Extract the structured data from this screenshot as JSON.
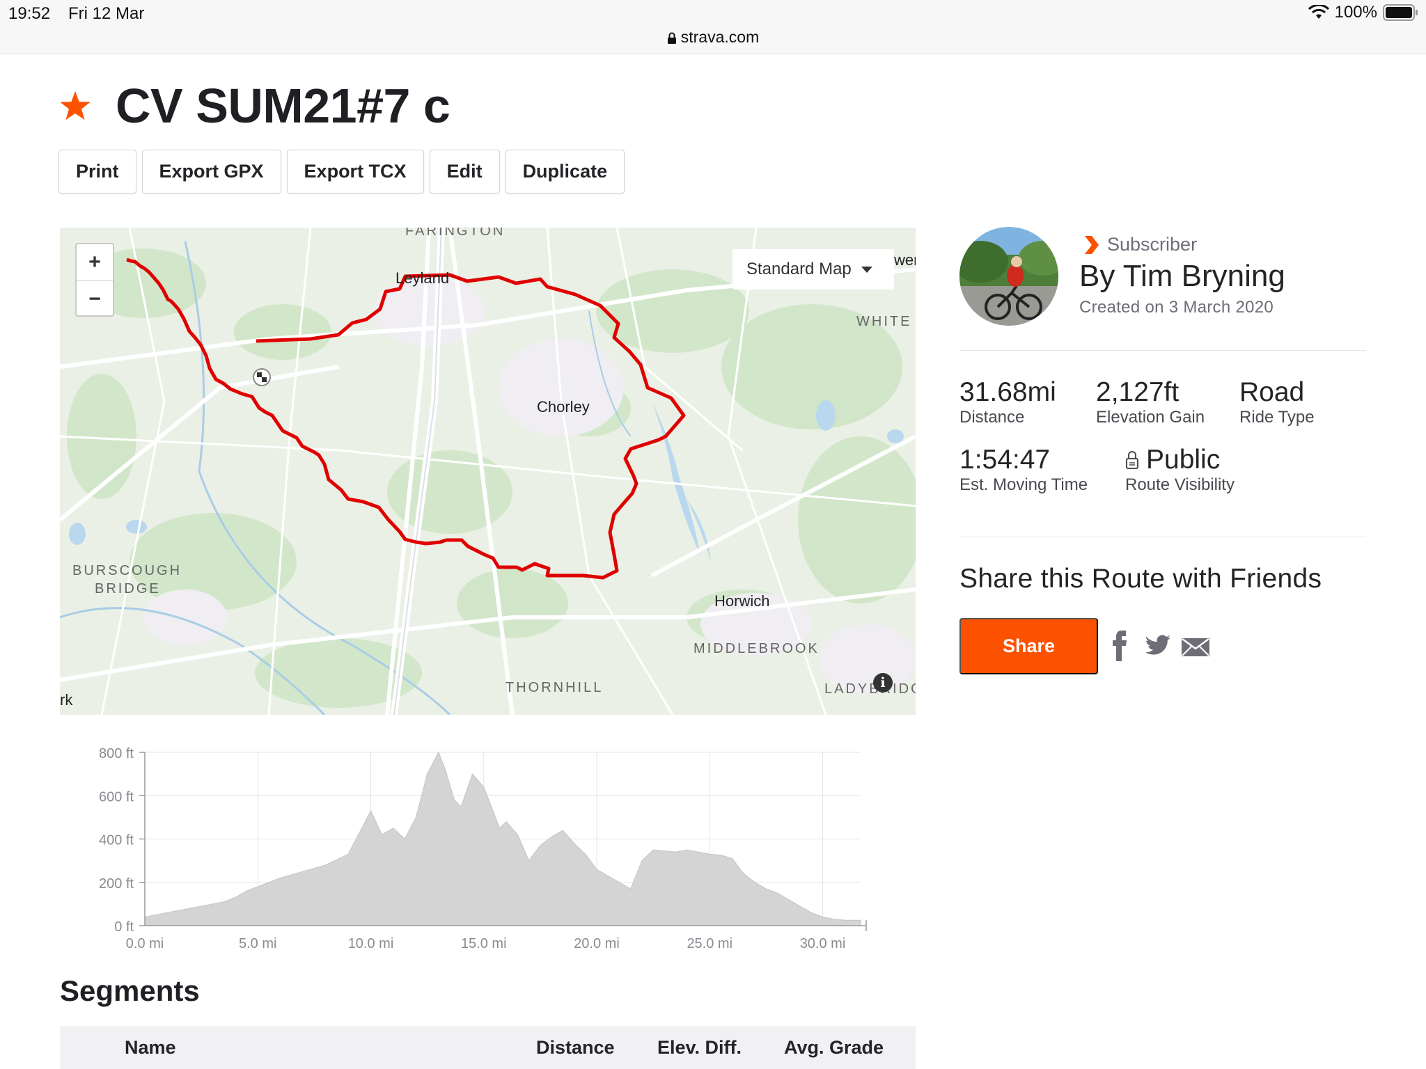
{
  "status_bar": {
    "time": "19:52",
    "date": "Fri 12 Mar",
    "battery": "100%",
    "url": "strava.com"
  },
  "route": {
    "title": "CV SUM21#7 c"
  },
  "toolbar": {
    "buttons": [
      "Print",
      "Export GPX",
      "Export TCX",
      "Edit",
      "Duplicate"
    ]
  },
  "map": {
    "map_type": "Standard Map",
    "places": {
      "faringtn": "FARINGTON",
      "leyland": "Leyland",
      "wer": "wer",
      "whitet": "WHITE",
      "chorley": "Chorley",
      "burscough1": "BURSCOUGH",
      "burscough2": "BRIDGE",
      "horwich": "Horwich",
      "middlebrook": "MIDDLEBROOK",
      "thornhill": "THORNHILL",
      "ladybridge": "LADYBRIDG",
      "rk": "rk"
    },
    "zoom_in": "+",
    "zoom_out": "−",
    "info": "i"
  },
  "elevation": {
    "y_ticks": [
      "800 ft",
      "600 ft",
      "400 ft",
      "200 ft",
      "0 ft"
    ],
    "x_ticks": [
      "0.0 mi",
      "5.0 mi",
      "10.0 mi",
      "15.0 mi",
      "20.0 mi",
      "25.0 mi",
      "30.0 mi"
    ],
    "fill_color": "#d4d4d4"
  },
  "chart_data": {
    "type": "area",
    "xlabel": "",
    "ylabel": "",
    "xlim": [
      0,
      31.68
    ],
    "ylim": [
      0,
      800
    ],
    "x": [
      0,
      1,
      2,
      3,
      3.5,
      4,
      4.5,
      5,
      6,
      7,
      8,
      9,
      9.5,
      10,
      10.5,
      11,
      11.5,
      12,
      12.5,
      13,
      13.3,
      13.7,
      14,
      14.5,
      15,
      15.3,
      15.7,
      16,
      16.5,
      17,
      17.5,
      18,
      18.5,
      19,
      19.5,
      20,
      20.5,
      21,
      21.5,
      22,
      22.5,
      23,
      23.5,
      24,
      24.5,
      25,
      25.5,
      26,
      26.5,
      27,
      27.5,
      28,
      28.5,
      29,
      29.5,
      30,
      30.5,
      31,
      31.68
    ],
    "y": [
      40,
      60,
      80,
      100,
      110,
      130,
      160,
      180,
      220,
      250,
      280,
      330,
      430,
      530,
      420,
      450,
      400,
      500,
      700,
      800,
      720,
      580,
      550,
      700,
      640,
      560,
      450,
      480,
      420,
      300,
      370,
      410,
      440,
      380,
      330,
      260,
      230,
      200,
      170,
      300,
      350,
      345,
      340,
      350,
      340,
      330,
      325,
      310,
      240,
      200,
      170,
      150,
      120,
      90,
      60,
      40,
      30,
      25,
      25
    ],
    "series": [
      {
        "values": "elevation_ft"
      }
    ],
    "grid": true,
    "legend": "none",
    "color": "#d4d4d4"
  },
  "segments": {
    "title": "Segments",
    "columns": [
      "Name",
      "Distance",
      "Elev. Diff.",
      "Avg. Grade"
    ]
  },
  "author": {
    "badge": "Subscriber",
    "name": "By Tim Bryning",
    "created": "Created on 3 March 2020"
  },
  "stats": {
    "distance": {
      "value": "31.68mi",
      "label": "Distance"
    },
    "elevation": {
      "value": "2,127ft",
      "label": "Elevation Gain"
    },
    "type": {
      "value": "Road",
      "label": "Ride Type"
    },
    "time": {
      "value": "1:54:47",
      "label": "Est. Moving Time"
    },
    "visibility": {
      "value": "Public",
      "label": "Route Visibility"
    }
  },
  "share": {
    "title": "Share this Route with Friends",
    "button": "Share"
  },
  "colors": {
    "brand": "#fc5200",
    "route_line": "#e00000"
  }
}
